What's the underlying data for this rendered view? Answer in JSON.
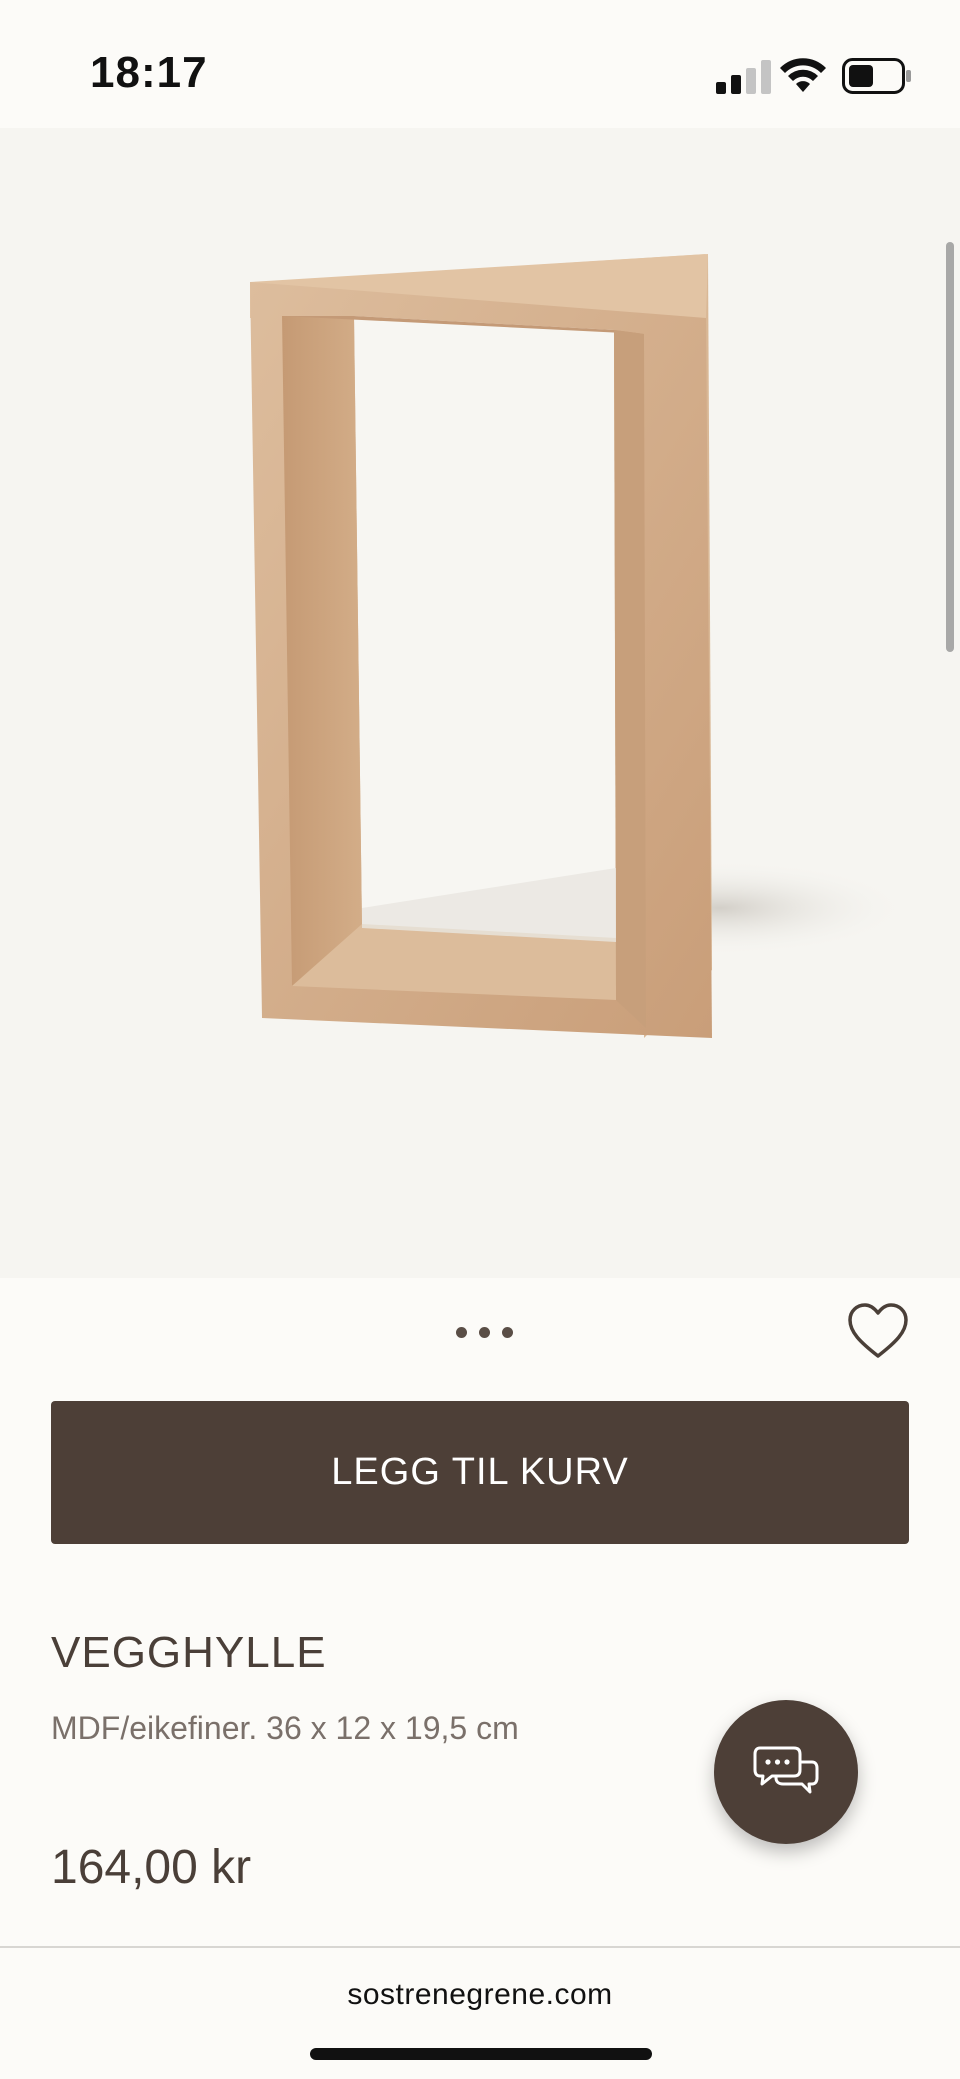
{
  "status_bar": {
    "time": "18:17",
    "signal_icon": "cellular-signal-icon",
    "wifi_icon": "wifi-icon",
    "battery_icon": "battery-icon",
    "battery_level": 0.4
  },
  "gallery": {
    "image": "wooden-wall-shelf-image",
    "dots_icon": "more-dots-icon"
  },
  "favorite": {
    "icon": "heart-icon"
  },
  "cart_button": {
    "label": "LEGG TIL KURV"
  },
  "product": {
    "title": "VEGGHYLLE",
    "description": "MDF/eikefiner. 36 x 12 x 19,5 cm",
    "price": "164,00 kr"
  },
  "chat": {
    "icon": "chat-bubbles-icon"
  },
  "browser": {
    "url": "sostrenegrene.com"
  },
  "colors": {
    "brand_brown": "#4d3f37",
    "background": "#fcfbf8",
    "image_bg": "#f6f5f1"
  }
}
